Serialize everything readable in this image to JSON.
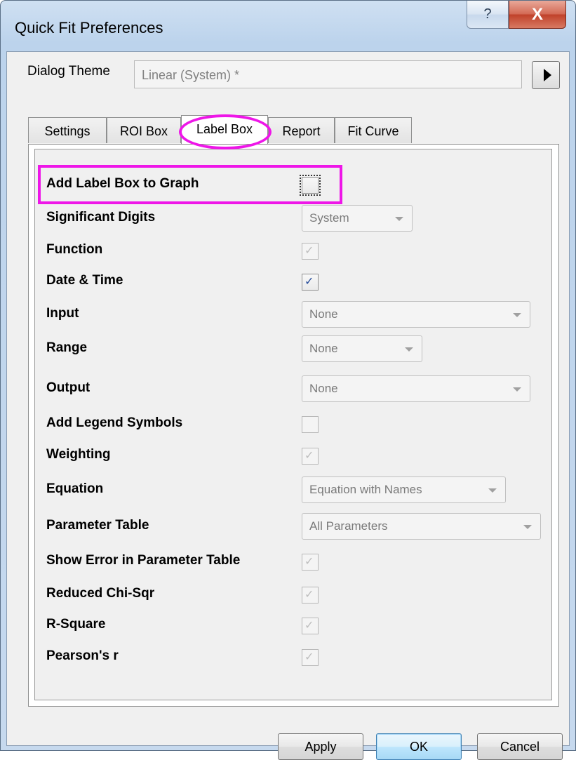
{
  "window": {
    "title": "Quick Fit Preferences",
    "help_glyph": "?",
    "close_glyph": "X"
  },
  "theme": {
    "label": "Dialog Theme",
    "value": "Linear (System) *",
    "arrow_icon": "triangle-right-icon"
  },
  "tabs": [
    {
      "label": "Settings",
      "active": false
    },
    {
      "label": "ROI Box",
      "active": false
    },
    {
      "label": "Label Box",
      "active": true
    },
    {
      "label": "Report",
      "active": false
    },
    {
      "label": "Fit Curve",
      "active": false
    }
  ],
  "settings": [
    {
      "label": "Add Label Box to Graph",
      "control": "checkbox",
      "checked": false,
      "enabled": true,
      "highlighted": true
    },
    {
      "label": "Significant Digits",
      "control": "combo",
      "value": "System",
      "enabled": false
    },
    {
      "label": "Function",
      "control": "checkbox",
      "checked": true,
      "enabled": false
    },
    {
      "label": "Date & Time",
      "control": "checkbox",
      "checked": true,
      "enabled": true
    },
    {
      "label": "Input",
      "control": "combo",
      "value": "None",
      "enabled": false
    },
    {
      "label": "Range",
      "control": "combo",
      "value": "None",
      "enabled": false
    },
    {
      "label": "Output",
      "control": "combo",
      "value": "None",
      "enabled": false
    },
    {
      "label": "Add Legend Symbols",
      "control": "checkbox",
      "checked": false,
      "enabled": false
    },
    {
      "label": "Weighting",
      "control": "checkbox",
      "checked": true,
      "enabled": false
    },
    {
      "label": "Equation",
      "control": "combo",
      "value": "Equation with Names",
      "enabled": false
    },
    {
      "label": "Parameter Table",
      "control": "combo",
      "value": "All Parameters",
      "enabled": false
    },
    {
      "label": "Show Error in Parameter Table",
      "control": "checkbox",
      "checked": true,
      "enabled": false
    },
    {
      "label": "Reduced Chi-Sqr",
      "control": "checkbox",
      "checked": true,
      "enabled": false
    },
    {
      "label": "R-Square",
      "control": "checkbox",
      "checked": true,
      "enabled": false
    },
    {
      "label": "Pearson's r",
      "control": "checkbox",
      "checked": true,
      "enabled": false
    }
  ],
  "buttons": {
    "apply": "Apply",
    "ok": "OK",
    "cancel": "Cancel"
  },
  "colors": {
    "highlight": "#ee16e8",
    "check_enabled": "#254b9a",
    "check_disabled": "#bdbdbd"
  }
}
